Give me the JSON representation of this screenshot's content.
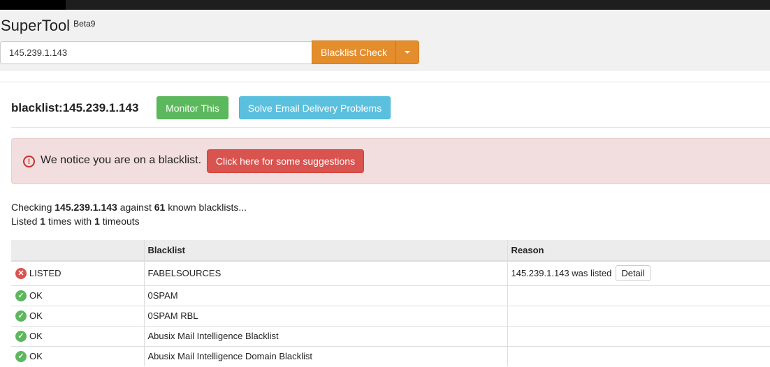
{
  "app": {
    "name": "SuperTool",
    "badge": "Beta9"
  },
  "search": {
    "value": "145.239.1.143",
    "button_label": "Blacklist Check"
  },
  "page": {
    "title": "blacklist:145.239.1.143",
    "monitor_label": "Monitor This",
    "solve_label": "Solve Email Delivery Problems"
  },
  "alert": {
    "text": "We notice you are on a blacklist.",
    "button_label": "Click here for some suggestions"
  },
  "summary": {
    "line1_prefix": "Checking",
    "ip": "145.239.1.143",
    "line1_mid": "against",
    "count": "61",
    "line1_suffix": "known blacklists...",
    "line2_prefix": "Listed",
    "listed": "1",
    "line2_mid": "times with",
    "timeouts": "1",
    "line2_suffix": "timeouts"
  },
  "table": {
    "headers": [
      "",
      "Blacklist",
      "Reason"
    ],
    "rows": [
      {
        "status": "LISTED",
        "blacklist": "FABELSOURCES",
        "reason": "145.239.1.143 was listed",
        "detail": "Detail"
      },
      {
        "status": "OK",
        "blacklist": "0SPAM",
        "reason": ""
      },
      {
        "status": "OK",
        "blacklist": "0SPAM RBL",
        "reason": ""
      },
      {
        "status": "OK",
        "blacklist": "Abusix Mail Intelligence Blacklist",
        "reason": ""
      },
      {
        "status": "OK",
        "blacklist": "Abusix Mail Intelligence Domain Blacklist",
        "reason": ""
      }
    ]
  },
  "colors": {
    "accent_orange": "#e38d2c",
    "success_green": "#5cb85c",
    "info_blue": "#5bc0de",
    "danger_red": "#d9534f",
    "alert_bg": "#f2dede"
  }
}
